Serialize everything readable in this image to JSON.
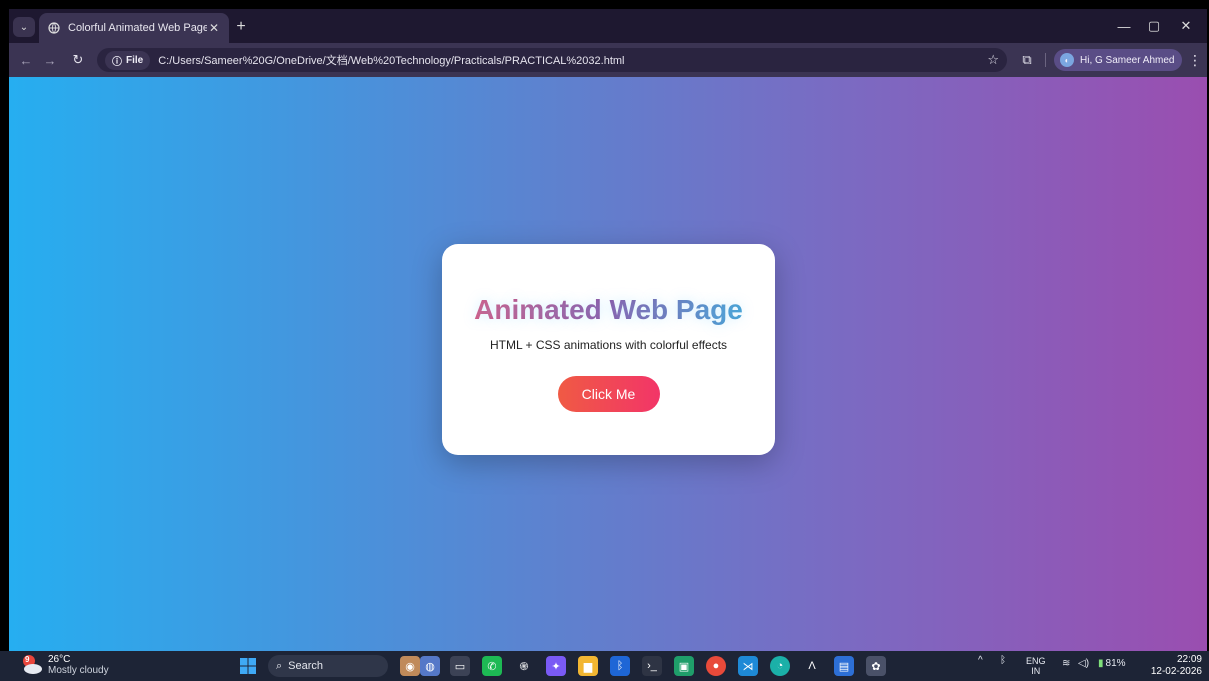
{
  "browser": {
    "tab_title": "Colorful Animated Web Page",
    "tab_close": "✕",
    "new_tab": "+",
    "file_chip": "File",
    "url": "C:/Users/Sameer%20G/OneDrive/文档/Web%20Technology/Practicals/PRACTICAL%2032.html",
    "profile_label": "Hi, G Sameer Ahmed"
  },
  "page": {
    "title": "Animated Web Page",
    "subtitle": "HTML + CSS animations with colorful effects",
    "button_label": "Click Me"
  },
  "taskbar": {
    "weather_temp": "26°C",
    "weather_desc": "Mostly cloudy",
    "weather_badge": "9",
    "search_label": "Search",
    "lang_top": "ENG",
    "lang_bottom": "IN",
    "battery": "81%",
    "time": "22:09",
    "date": "12-02-2026"
  },
  "colors": {
    "gradient_left": "#26aef0",
    "gradient_right": "#9a4eb0",
    "button_left": "#f05a44",
    "button_right": "#f23568"
  },
  "icons": [
    "tab-search-icon",
    "globe-icon",
    "back-icon",
    "forward-icon",
    "reload-icon",
    "info-icon",
    "star-icon",
    "extensions-icon",
    "menu-icon",
    "windows-start-icon",
    "search-icon",
    "whatsapp-icon",
    "chatgpt-icon",
    "file-explorer-icon",
    "bluetooth-icon",
    "terminal-icon",
    "chrome-icon",
    "vscode-icon",
    "edge-icon",
    "wifi-icon",
    "volume-icon",
    "battery-icon"
  ]
}
